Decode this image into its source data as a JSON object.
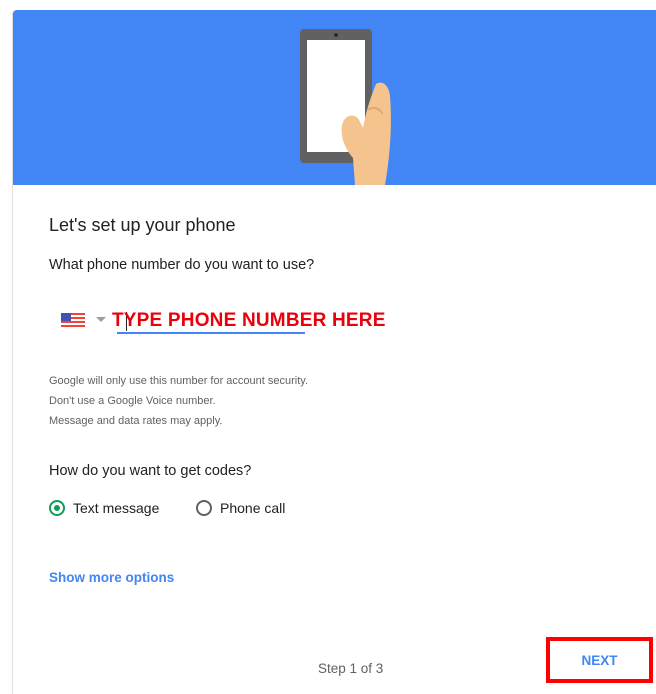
{
  "header": {
    "illustration_icon": "phone-in-hand-icon",
    "banner_color": "#4285f4"
  },
  "form": {
    "title": "Let's set up your phone",
    "question": "What phone number do you want to use?",
    "country_flag_icon": "us-flag-icon",
    "phone_input_value": "",
    "phone_input_overlay": "TYPE PHONE NUMBER HERE",
    "info_lines": [
      "Google will only use this number for account security.",
      "Don't use a Google Voice number.",
      "Message and data rates may apply."
    ],
    "codes_question": "How do you want to get codes?",
    "options": [
      {
        "label": "Text message",
        "selected": true
      },
      {
        "label": "Phone call",
        "selected": false
      }
    ],
    "show_more_label": "Show more options"
  },
  "footer": {
    "step_text": "Step 1 of 3",
    "next_label": "NEXT",
    "highlight_color": "#ff0000"
  },
  "colors": {
    "accent": "#4285f4",
    "radio_selected": "#0f9d58",
    "annotation_red": "#e8000b"
  }
}
